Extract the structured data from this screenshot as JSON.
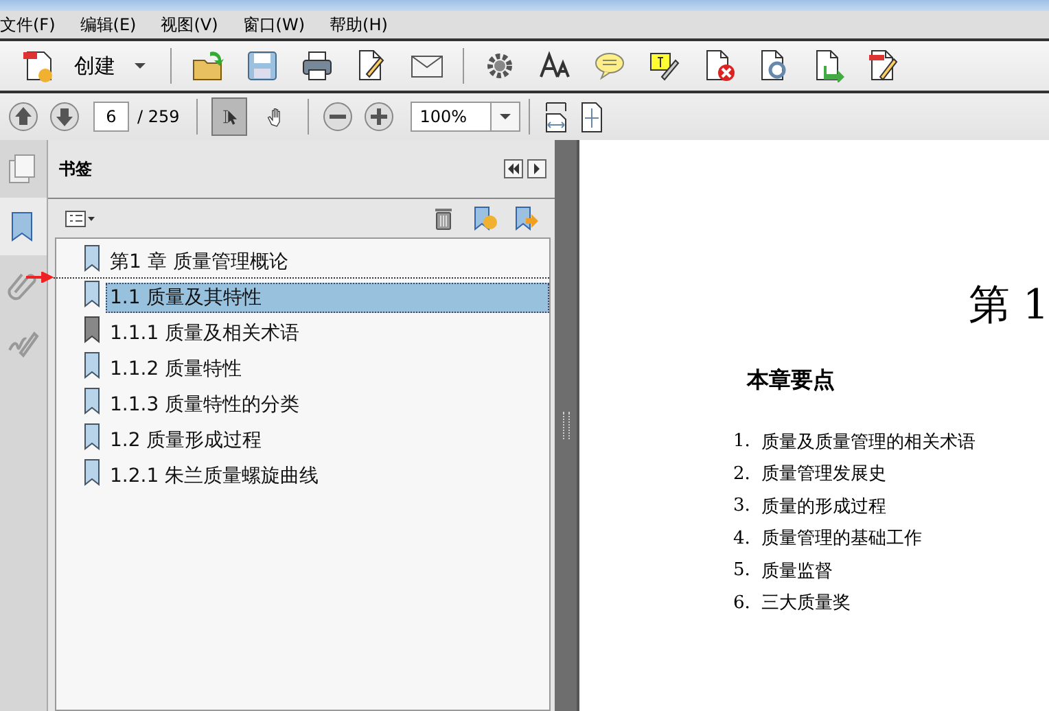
{
  "menu": [
    "文件(F)",
    "编辑(E)",
    "视图(V)",
    "窗口(W)",
    "帮助(H)"
  ],
  "toolbar": {
    "create_label": "创建"
  },
  "nav": {
    "page": "6",
    "total": "/ 259",
    "zoom": "100%",
    "tools": [
      {
        "kind": "select",
        "selected": true
      },
      {
        "kind": "hand",
        "selected": false
      }
    ]
  },
  "sidebar": {
    "tabs": [
      {
        "kind": "pages",
        "selected": false
      },
      {
        "kind": "bookmarks",
        "selected": true
      },
      {
        "kind": "attachments",
        "selected": false
      },
      {
        "kind": "signatures",
        "selected": false
      }
    ]
  },
  "bookmarks": {
    "title": "书签",
    "items": [
      {
        "label": "第1 章 质量管理概论",
        "selected": false,
        "dimmed": false
      },
      {
        "label": "1.1 质量及其特性",
        "selected": true,
        "dimmed": false,
        "drop_target": true
      },
      {
        "label": "1.1.1 质量及相关术语",
        "selected": false,
        "dimmed": true
      },
      {
        "label": "1.1.2 质量特性",
        "selected": false,
        "dimmed": false
      },
      {
        "label": "1.1.3 质量特性的分类",
        "selected": false,
        "dimmed": false
      },
      {
        "label": "1.2 质量形成过程",
        "selected": false,
        "dimmed": false
      },
      {
        "label": "1.2.1 朱兰质量螺旋曲线",
        "selected": false,
        "dimmed": false
      }
    ]
  },
  "document": {
    "chapter_heading": "第 1",
    "section_title": "本章要点",
    "points": [
      {
        "number": "1.",
        "text": "质量及质量管理的相关术语"
      },
      {
        "number": "2.",
        "text": "质量管理发展史"
      },
      {
        "number": "3.",
        "text": "质量的形成过程"
      },
      {
        "number": "4.",
        "text": "质量管理的基础工作"
      },
      {
        "number": "5.",
        "text": "质量监督"
      },
      {
        "number": "6.",
        "text": "三大质量奖"
      }
    ]
  }
}
